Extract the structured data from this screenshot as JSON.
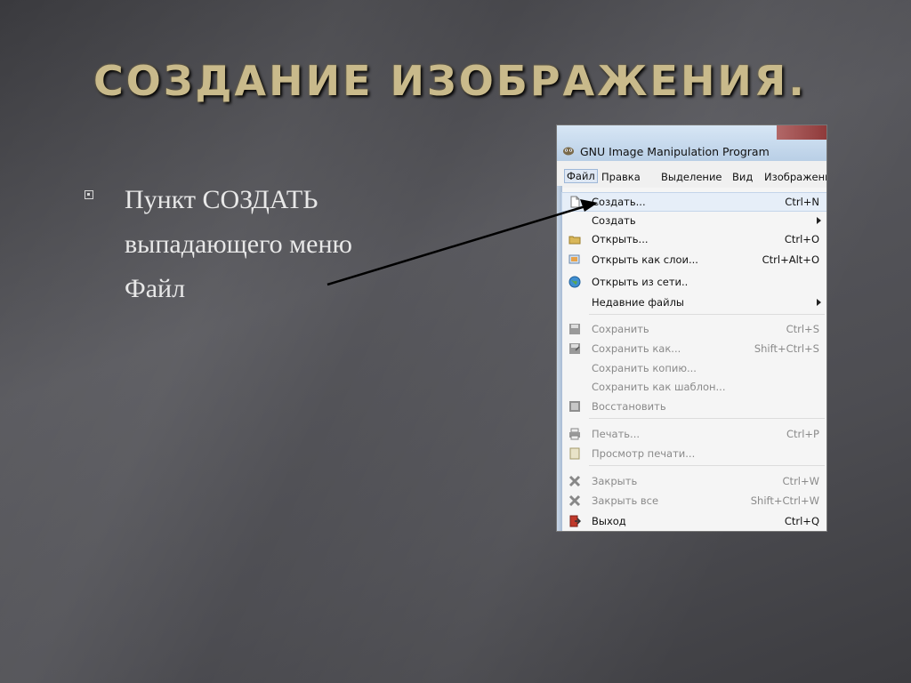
{
  "slide": {
    "title": "СОЗДАНИЕ ИЗОБРАЖЕНИЯ.",
    "bullet_text": "Пункт СОЗДАТЬ выпадающего меню Файл"
  },
  "window": {
    "title": "GNU Image Manipulation Program",
    "menubar": [
      "Файл",
      "Правка",
      "Выделение",
      "Вид",
      "Изображени"
    ]
  },
  "file_menu": {
    "items": [
      {
        "label": "Создать...",
        "shortcut": "Ctrl+N",
        "icon": "new-file-icon",
        "enabled": true
      },
      {
        "label": "Создать",
        "shortcut": "",
        "icon": "",
        "enabled": true,
        "submenu": true
      },
      {
        "label": "Открыть...",
        "shortcut": "Ctrl+O",
        "icon": "open-folder-icon",
        "enabled": true
      },
      {
        "label": "Открыть как слои...",
        "shortcut": "Ctrl+Alt+O",
        "icon": "open-layers-icon",
        "enabled": true
      },
      {
        "label": "Открыть из сети..",
        "shortcut": "",
        "icon": "globe-icon",
        "enabled": true
      },
      {
        "label": "Недавние файлы",
        "shortcut": "",
        "icon": "",
        "enabled": true,
        "submenu": true
      },
      {
        "label": "Сохранить",
        "shortcut": "Ctrl+S",
        "icon": "save-icon",
        "enabled": false
      },
      {
        "label": "Сохранить как...",
        "shortcut": "Shift+Ctrl+S",
        "icon": "save-as-icon",
        "enabled": false
      },
      {
        "label": "Сохранить копию...",
        "shortcut": "",
        "icon": "",
        "enabled": false
      },
      {
        "label": "Сохранить как шаблон...",
        "shortcut": "",
        "icon": "",
        "enabled": false
      },
      {
        "label": "Восстановить",
        "shortcut": "",
        "icon": "revert-icon",
        "enabled": false
      },
      {
        "label": "Печать...",
        "shortcut": "Ctrl+P",
        "icon": "print-icon",
        "enabled": false
      },
      {
        "label": "Просмотр печати...",
        "shortcut": "",
        "icon": "print-preview-icon",
        "enabled": false
      },
      {
        "label": "Закрыть",
        "shortcut": "Ctrl+W",
        "icon": "close-icon",
        "enabled": false
      },
      {
        "label": "Закрыть все",
        "shortcut": "Shift+Ctrl+W",
        "icon": "close-all-icon",
        "enabled": false
      },
      {
        "label": "Выход",
        "shortcut": "Ctrl+Q",
        "icon": "quit-icon",
        "enabled": true
      }
    ]
  }
}
